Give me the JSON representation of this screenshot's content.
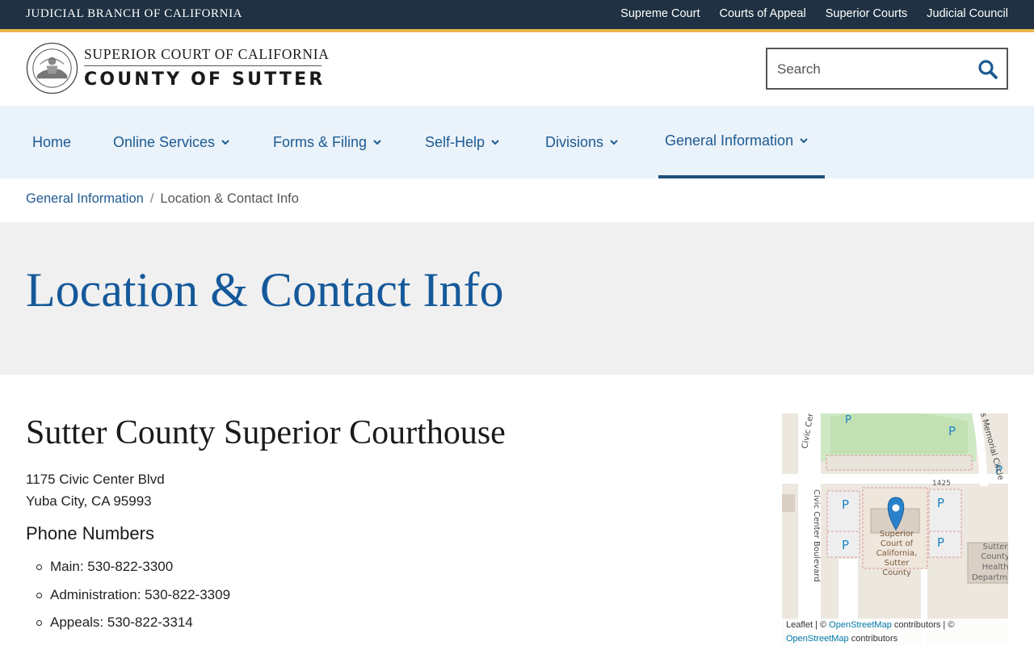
{
  "topbar": {
    "brand": "JUDICIAL BRANCH OF CALIFORNIA",
    "links": [
      "Supreme Court",
      "Courts of Appeal",
      "Superior Courts",
      "Judicial Council"
    ]
  },
  "header": {
    "line1": "SUPERIOR COURT OF CALIFORNIA",
    "line2": "COUNTY OF SUTTER",
    "search_placeholder": "Search"
  },
  "nav": {
    "home": "Home",
    "online": "Online Services",
    "forms": "Forms & Filing",
    "selfhelp": "Self-Help",
    "divisions": "Divisions",
    "general": "General Information"
  },
  "breadcrumb": {
    "parent": "General Information",
    "sep": "/",
    "current": "Location & Contact Info"
  },
  "page": {
    "title": "Location & Contact Info",
    "section_title": "Sutter County Superior Courthouse",
    "address_line1": "1175 Civic Center Blvd",
    "address_line2": "Yuba City, CA 95993",
    "phone_heading": "Phone Numbers",
    "phones": [
      "Main: 530-822-3300",
      "Administration: 530-822-3309",
      "Appeals: 530-822-3314"
    ]
  },
  "map": {
    "labels": {
      "civic_center_blvd": "Civic Center Boulevard",
      "civic_center_short": "Civic Cen",
      "memorial_circle": "s Memorial Circle",
      "address_number": "1425",
      "court_label_1": "Superior",
      "court_label_2": "Court of",
      "court_label_3": "California,",
      "court_label_4": "Sutter",
      "court_label_5": "County",
      "health_1": "Sutter",
      "health_2": "County",
      "health_3": "Health",
      "health_4": "Departm",
      "parking": "P"
    },
    "attribution": {
      "leaflet": "Leaflet",
      "sep1": " | © ",
      "osm1": "OpenStreetMap",
      "contrib1": " contributors | © ",
      "osm2": "OpenStreetMap",
      "contrib2": " contributors"
    }
  },
  "colors": {
    "topbar_bg": "#1f3142",
    "gold_accent": "#e8b84a",
    "nav_bg": "#eaf2fa",
    "link_blue": "#1d5a91",
    "title_blue": "#15599a"
  }
}
